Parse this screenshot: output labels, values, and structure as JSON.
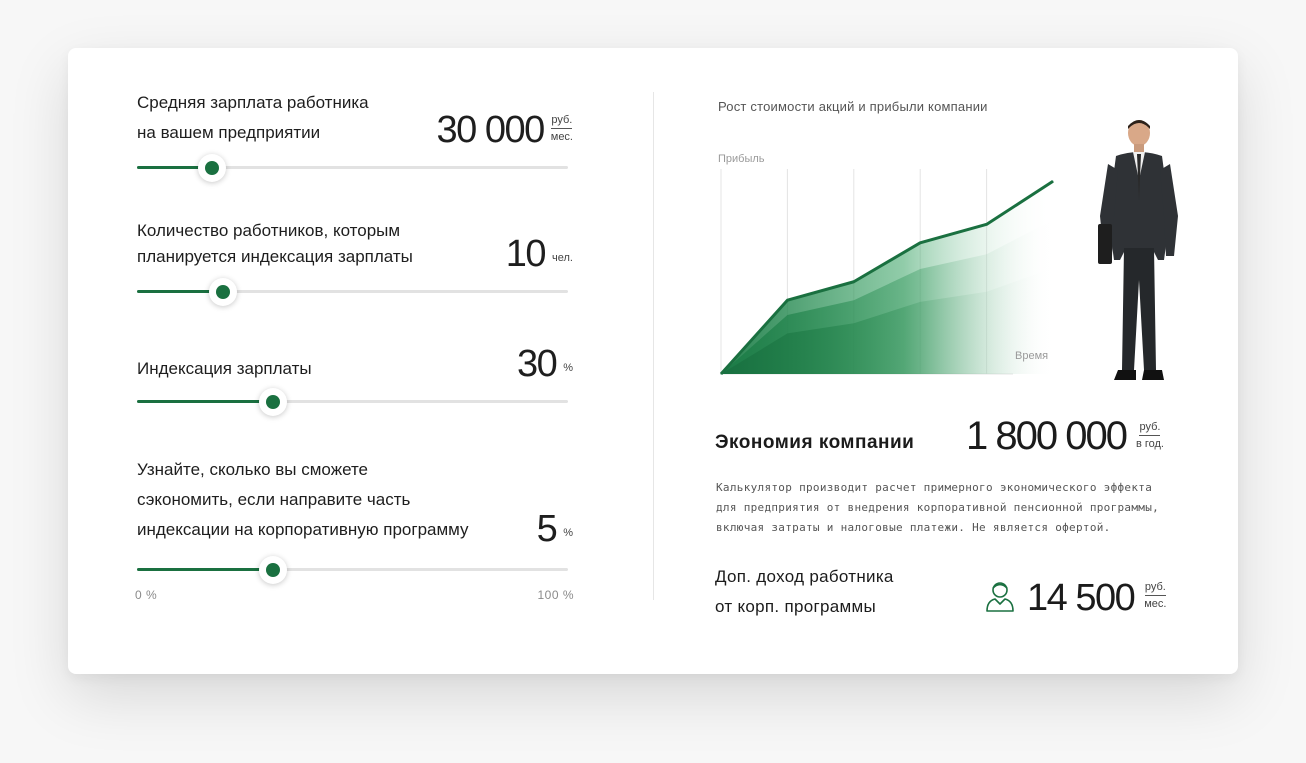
{
  "calculator": {
    "salary": {
      "label_line1": "Средняя зарплата работника",
      "label_line2": "на вашем предприятии",
      "value": "30 000",
      "unit_top": "руб.",
      "unit_bottom": "мес.",
      "slider_fraction": 0.175
    },
    "employees": {
      "label_line1": "Количество работников, которым",
      "label_line2": "планируется индексация зарплаты",
      "value": "10",
      "unit": "чел.",
      "slider_fraction": 0.2
    },
    "indexation": {
      "label": "Индексация зарплаты",
      "value": "30",
      "unit": "%",
      "slider_fraction": 0.315
    },
    "share": {
      "label_line1": "Узнайте, сколько вы сможете",
      "label_line2": "сэкономить, если направите часть",
      "label_line3": "индексации на корпоративную программу",
      "value": "5",
      "unit": "%",
      "slider_fraction": 0.315,
      "scale_min": "0 %",
      "scale_max": "100 %"
    }
  },
  "chart": {
    "title": "Рост стоимости акций и прибыли компании",
    "y_label": "Прибыль",
    "x_label": "Время",
    "accent_color": "#1a7040"
  },
  "chart_data": {
    "type": "area",
    "title": "Рост стоимости акций и прибыли компании",
    "xlabel": "Время",
    "ylabel": "Прибыль",
    "x": [
      0,
      1,
      2,
      3,
      4,
      5
    ],
    "series": [
      {
        "values": [
          0,
          36,
          45,
          64,
          73,
          94
        ]
      }
    ],
    "ylim": [
      0,
      100
    ],
    "grid": "vertical"
  },
  "results": {
    "savings_label": "Экономия компании",
    "savings_value": "1 800 000",
    "savings_unit_top": "руб.",
    "savings_unit_bottom": "в год.",
    "disclaimer": "Калькулятор производит расчет примерного экономического эффекта для предприятия от внедрения корпоративной пенсионной программы, включая затраты и налоговые платежи. Не является офертой.",
    "income_label_line1": "Доп. доход работника",
    "income_label_line2": "от корп. программы",
    "income_icon": "person-icon",
    "income_value": "14 500",
    "income_unit_top": "руб.",
    "income_unit_bottom": "мес."
  }
}
